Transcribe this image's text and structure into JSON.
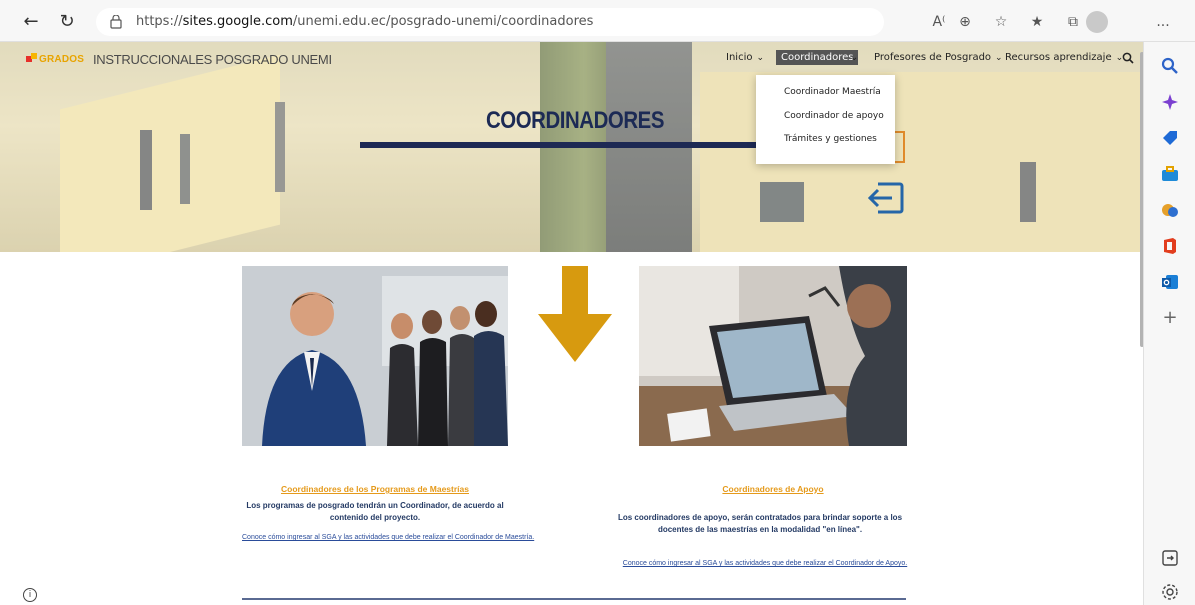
{
  "browser": {
    "url_prefix": "https://",
    "url_domain": "sites.google.com",
    "url_path": "/unemi.edu.ec/posgrado-unemi/coordinadores",
    "more_label": "..."
  },
  "site": {
    "logo_text": "GRADOS",
    "logo_small": "UNEMI",
    "title": "INSTRUCCIONALES POSGRADO UNEMI",
    "nav": [
      {
        "label": "Inicio"
      },
      {
        "label": "Coordinadores"
      },
      {
        "label": "Profesores de Posgrado"
      },
      {
        "label": "Recursos aprendizaje"
      }
    ],
    "dropdown": [
      "Coordinador Maestría",
      "Coordinador de apoyo",
      "Trámites y gestiones"
    ]
  },
  "hero": {
    "title": "COORDINADORES"
  },
  "sections": {
    "left": {
      "title": "Coordinadores de los Programas de Maestrías",
      "body": "Los programas de posgrado tendrán un Coordinador, de acuerdo al contenido del proyecto.",
      "link": "Conoce cómo ingresar al SGA y las actividades que debe realizar el Coordinador de Maestría."
    },
    "right": {
      "title": "Coordinadores de Apoyo",
      "body": "Los coordinadores de apoyo, serán contratados para brindar soporte a los docentes de las maestrías en la modalidad \"en línea\".",
      "link": "Conoce cómo ingresar al SGA y las actividades que debe realizar el Coordinador de Apoyo."
    }
  },
  "colors": {
    "accent_orange": "#e59a1b",
    "title_navy": "#1c2a55",
    "arrow_gold": "#d79a0f"
  }
}
